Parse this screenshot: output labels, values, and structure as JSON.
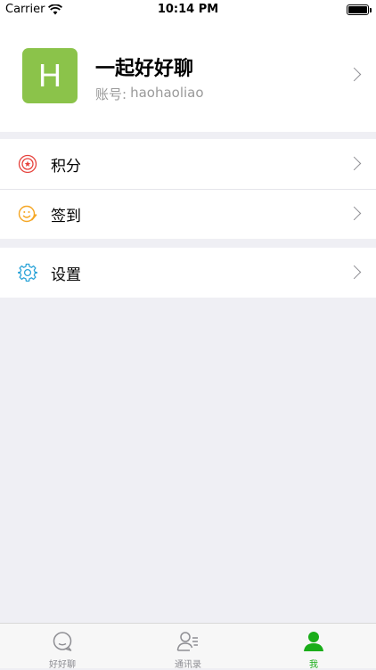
{
  "status_bar": {
    "carrier": "Carrier",
    "time": "10:14 PM"
  },
  "profile": {
    "avatar_letter": "H",
    "name": "一起好好聊",
    "account_label": "账号:",
    "account_id": "haohaoliao"
  },
  "menu_group_1": [
    {
      "label": "积分",
      "icon": "points-icon"
    },
    {
      "label": "签到",
      "icon": "checkin-icon"
    }
  ],
  "menu_group_2": [
    {
      "label": "设置",
      "icon": "settings-gear-icon"
    }
  ],
  "tabbar": {
    "tabs": [
      {
        "label": "好好聊",
        "icon": "chat-bubble-icon",
        "active": false
      },
      {
        "label": "通讯录",
        "icon": "contacts-icon",
        "active": false
      },
      {
        "label": "我",
        "icon": "me-person-icon",
        "active": true
      }
    ]
  },
  "colors": {
    "accent_green": "#1aad19",
    "avatar_green": "#8bc34a",
    "points_red": "#e6423c",
    "checkin_orange": "#f5a623",
    "settings_blue": "#2aa3d8"
  }
}
